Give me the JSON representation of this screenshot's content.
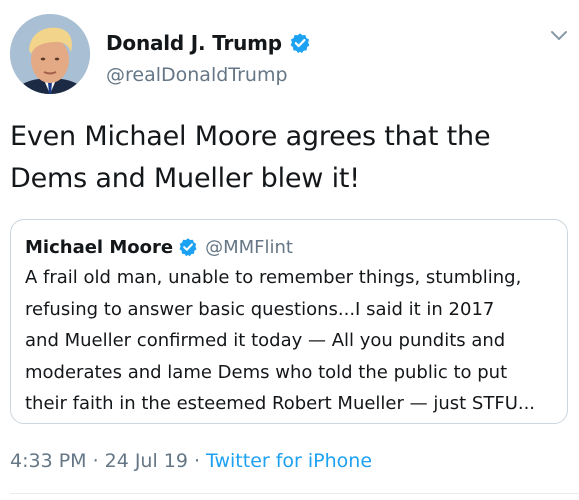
{
  "author": {
    "name": "Donald J. Trump",
    "handle": "@realDonaldTrump",
    "verified_color": "#1da1f2",
    "avatar_icon": "profile-photo"
  },
  "tweet": {
    "text_lines": [
      "Even Michael Moore agrees that the",
      "Dems and Mueller blew it!"
    ]
  },
  "quoted_tweet": {
    "name": "Michael Moore",
    "handle": "@MMFlint",
    "text_lines": [
      "A frail old man, unable to remember things, stumbling,",
      "refusing to answer basic questions...I said it in 2017",
      "and Mueller confirmed it today — All you pundits and",
      "moderates and lame Dems who told the public to put",
      "their faith in the esteemed Robert Mueller — just STFU..."
    ]
  },
  "meta": {
    "time": "4:33 PM",
    "separator": "·",
    "date": "24 Jul 19",
    "source": "Twitter for iPhone",
    "link_color": "#1da1f2"
  },
  "icons": {
    "menu": "chevron-down-icon"
  }
}
